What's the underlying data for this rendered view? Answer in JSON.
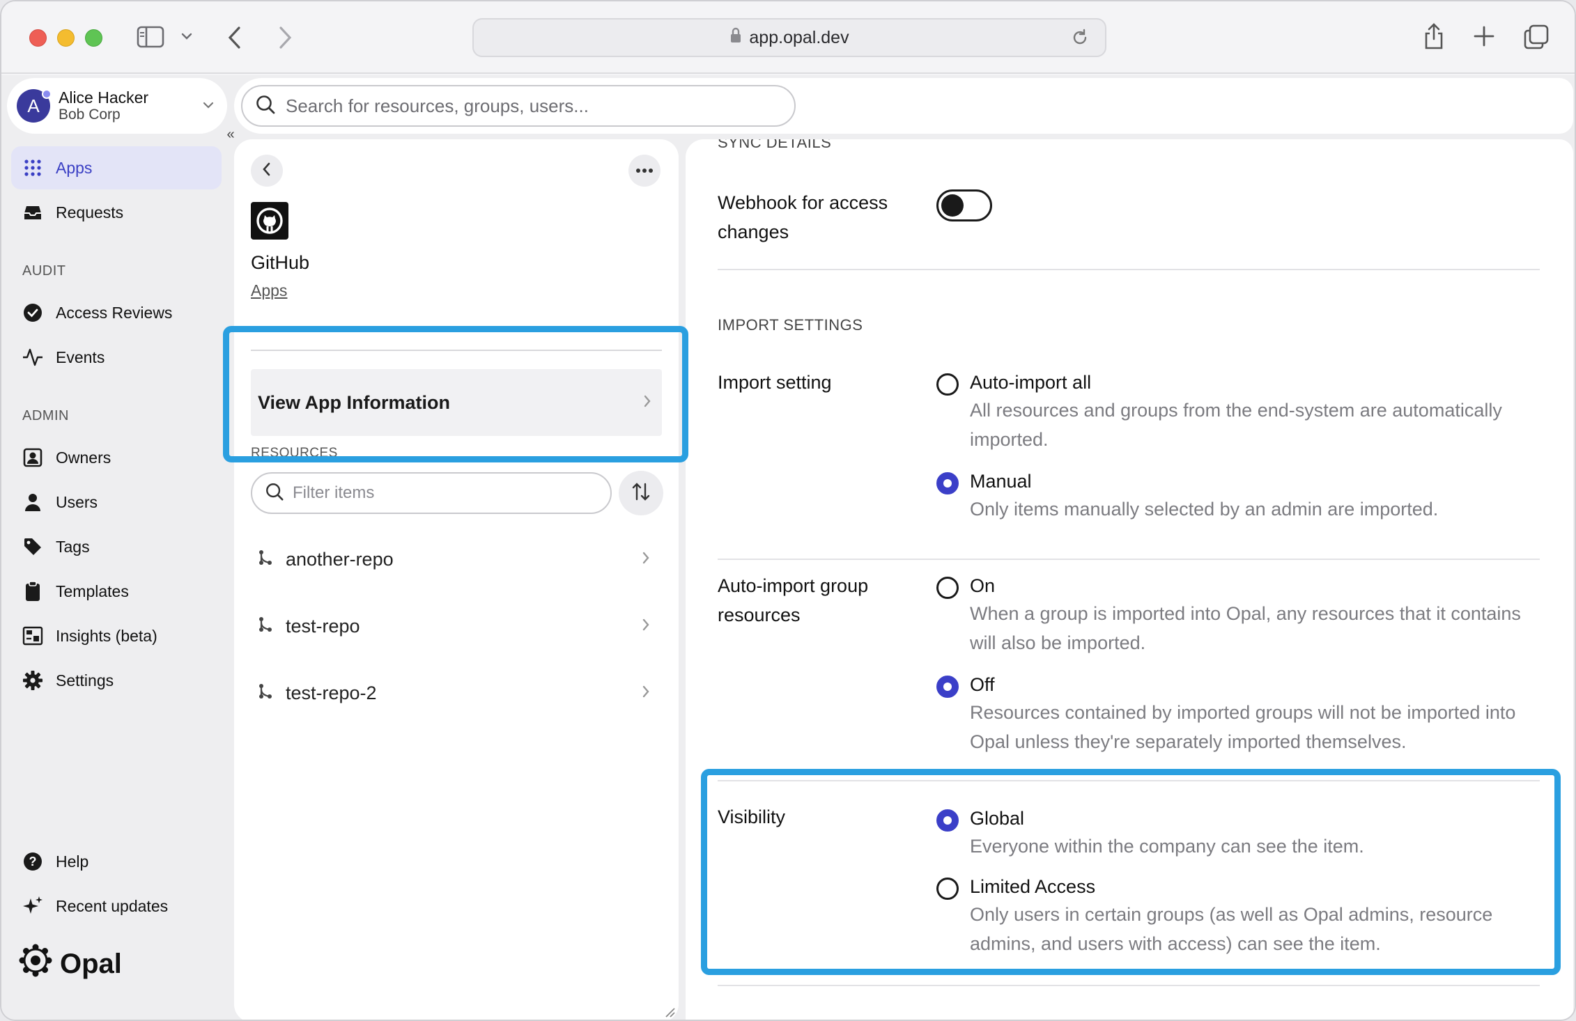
{
  "browser": {
    "url": "app.opal.dev"
  },
  "user": {
    "initial": "A",
    "name": "Alice Hacker",
    "org": "Bob Corp"
  },
  "search": {
    "placeholder": "Search for resources, groups, users..."
  },
  "nav": {
    "collapse_label": "«",
    "primary": [
      {
        "label": "Apps",
        "icon": "apps-grid-icon",
        "active": true
      },
      {
        "label": "Requests",
        "icon": "inbox-icon",
        "active": false
      }
    ],
    "audit_heading": "AUDIT",
    "audit": [
      {
        "label": "Access Reviews",
        "icon": "check-circle-icon"
      },
      {
        "label": "Events",
        "icon": "activity-icon"
      }
    ],
    "admin_heading": "ADMIN",
    "admin": [
      {
        "label": "Owners",
        "icon": "owner-badge-icon"
      },
      {
        "label": "Users",
        "icon": "user-icon"
      },
      {
        "label": "Tags",
        "icon": "tag-icon"
      },
      {
        "label": "Templates",
        "icon": "clipboard-icon"
      },
      {
        "label": "Insights (beta)",
        "icon": "insights-icon"
      },
      {
        "label": "Settings",
        "icon": "gear-icon"
      }
    ],
    "footer": [
      {
        "label": "Help",
        "icon": "help-circle-icon"
      },
      {
        "label": "Recent updates",
        "icon": "sparkle-icon"
      }
    ],
    "logo_text": "Opal"
  },
  "app_panel": {
    "name": "GitHub",
    "breadcrumb": "Apps",
    "view_app_info": "View App Information",
    "resources_heading": "RESOURCES",
    "filter_placeholder": "Filter items",
    "resources": [
      {
        "name": "another-repo"
      },
      {
        "name": "test-repo"
      },
      {
        "name": "test-repo-2"
      }
    ]
  },
  "details": {
    "sync_heading": "SYNC DETAILS",
    "webhook_label": "Webhook for access changes",
    "webhook_enabled": false,
    "import_heading": "IMPORT SETTINGS",
    "import_setting": {
      "label": "Import setting",
      "options": [
        {
          "title": "Auto-import all",
          "desc": "All resources and groups from the end-system are automatically imported.",
          "selected": false
        },
        {
          "title": "Manual",
          "desc": "Only items manually selected by an admin are imported.",
          "selected": true
        }
      ]
    },
    "auto_import_group": {
      "label": "Auto-import group resources",
      "options": [
        {
          "title": "On",
          "desc": "When a group is imported into Opal, any resources that it contains will also be imported.",
          "selected": false
        },
        {
          "title": "Off",
          "desc": "Resources contained by imported groups will not be imported into Opal unless they're separately imported themselves.",
          "selected": true
        }
      ]
    },
    "visibility": {
      "label": "Visibility",
      "options": [
        {
          "title": "Global",
          "desc": "Everyone within the company can see the item.",
          "selected": true
        },
        {
          "title": "Limited Access",
          "desc": "Only users in certain groups (as well as Opal admins, resource admins, and users with access) can see the item.",
          "selected": false
        }
      ]
    }
  },
  "colors": {
    "accent": "#3b3fc8",
    "highlight": "#2a9fe0",
    "active_nav_bg": "#e3e4f7"
  }
}
